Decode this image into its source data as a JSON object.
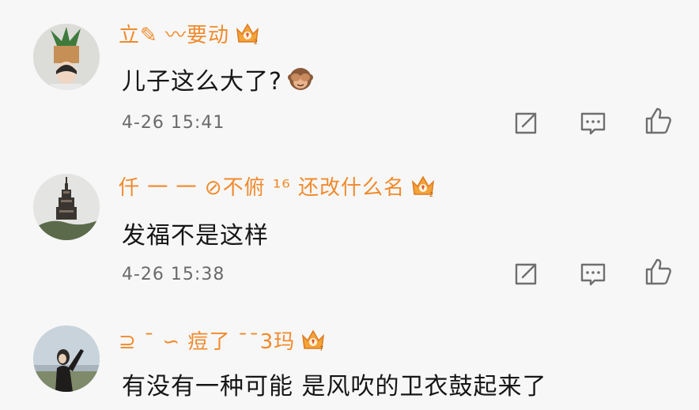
{
  "comments": [
    {
      "username": "立✎ 〰要动",
      "text": "儿子这么大了?",
      "emoji": "see-no-evil-monkey",
      "time": "4-26 15:41"
    },
    {
      "username": "仟 一 一 ⊘不俯 ¹⁶ 还改什么名",
      "text": "发福不是这样",
      "time": "4-26 15:38"
    },
    {
      "username": "⊇ ˉ ∽ 痘了 ˉˉ3玛",
      "text": "有没有一种可能 是风吹的卫衣鼓起来了",
      "time": ""
    }
  ],
  "icons": {
    "share": "share-icon",
    "comment": "comment-icon",
    "like": "like-icon",
    "crown": "vip-crown-icon"
  },
  "colors": {
    "username": "#f08a2c",
    "background": "#f7f7f7",
    "crown": "#f2a33a"
  }
}
